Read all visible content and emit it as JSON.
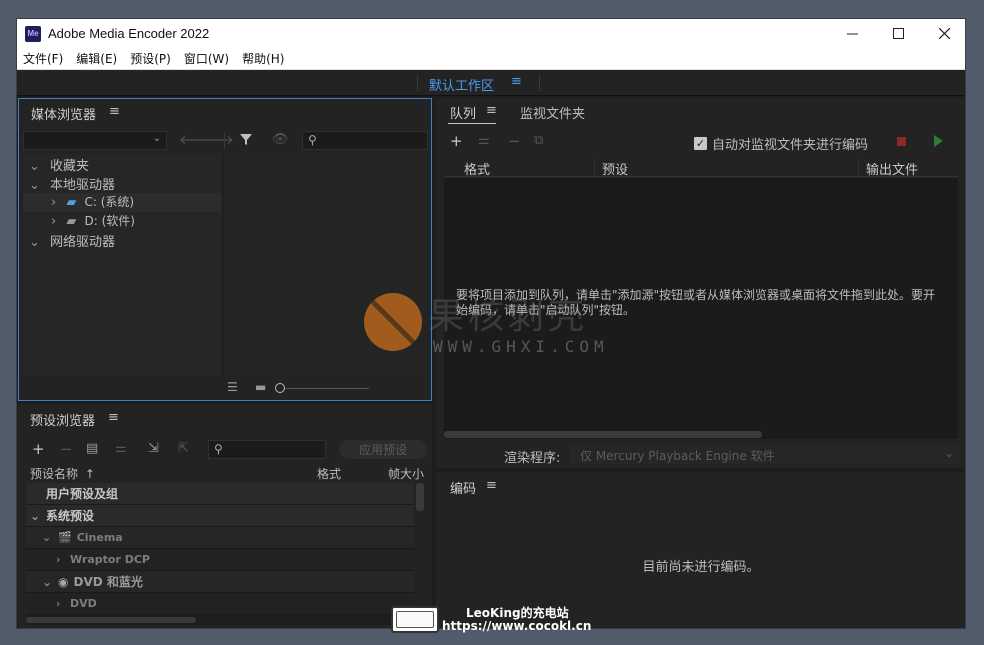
{
  "window": {
    "title": "Adobe Media Encoder 2022",
    "logo_text": "Me"
  },
  "menu": [
    "文件(F)",
    "编辑(E)",
    "预设(P)",
    "窗口(W)",
    "帮助(H)"
  ],
  "workspace": {
    "label": "默认工作区",
    "menu_icon": "≡"
  },
  "media_browser": {
    "title": "媒体浏览器",
    "tree": {
      "favorites": "收藏夹",
      "local_drives": "本地驱动器",
      "drive_c": "C: (系统)",
      "drive_d": "D: (软件)",
      "network_drives": "网络驱动器"
    }
  },
  "queue_panel": {
    "tab_queue": "队列",
    "tab_watch": "监视文件夹",
    "auto_encode_label": "自动对监视文件夹进行编码",
    "auto_encode_checked": true,
    "columns": {
      "format": "格式",
      "preset": "预设",
      "output": "输出文件"
    },
    "hint": "要将项目添加到队列，请单击\"添加源\"按钮或者从媒体浏览器或桌面将文件拖到此处。要开始编码，请单击\"启动队列\"按钮。",
    "renderer_label": "渲染程序:",
    "renderer_value": "仅 Mercury Playback Engine 软件"
  },
  "preset_browser": {
    "title": "预设浏览器",
    "apply_button": "应用预设",
    "columns": {
      "name": "预设名称",
      "format": "格式",
      "frame": "帧大小"
    },
    "rows": {
      "user": "用户预设及组",
      "system": "系统预设",
      "cinema": "Cinema",
      "wraptor": "Wraptor DCP",
      "dvd_bluray": "DVD 和蓝光",
      "dvd": "DVD"
    }
  },
  "encoding_panel": {
    "title": "编码",
    "status": "目前尚未进行编码。"
  },
  "watermark": {
    "site_logo_text": "果核剥壳",
    "site_url": "WWW.GHXI.COM",
    "badge_name": "LeoKing的充电站",
    "badge_url": "https://www.cocokl.cn"
  },
  "colors": {
    "accent": "#4a9cf2",
    "panel_bg": "#232323",
    "window_bg": "#1d1d1d",
    "desktop": "#515b6a",
    "start_button": "#2f7d32",
    "stop_button": "#8a2a2a"
  }
}
